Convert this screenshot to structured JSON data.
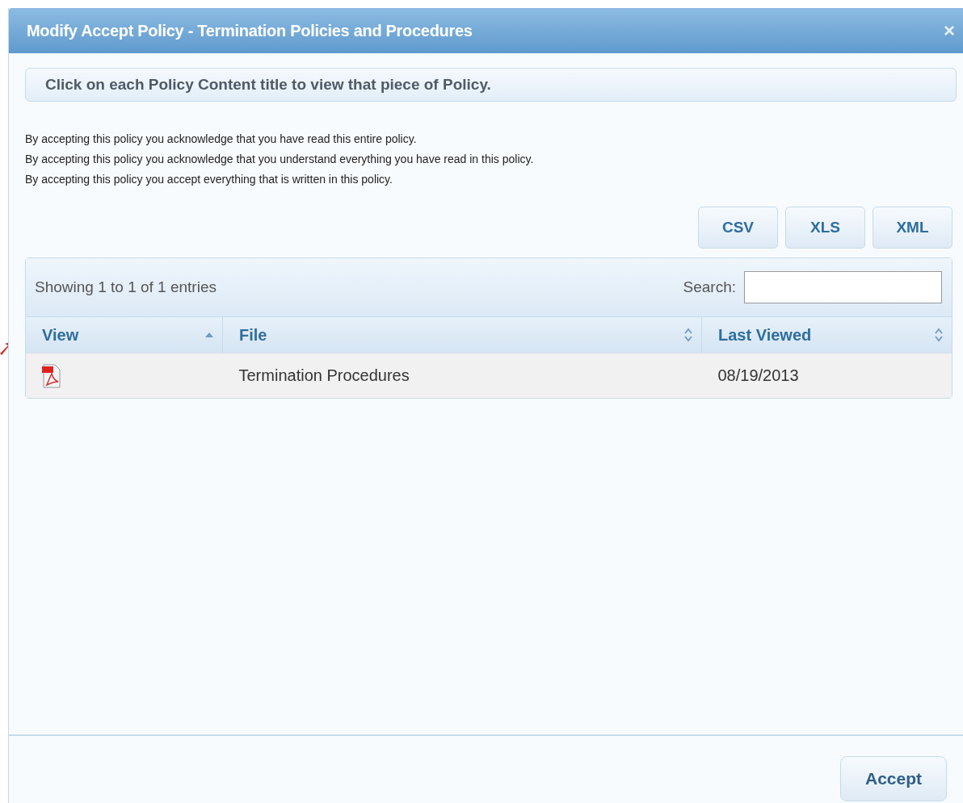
{
  "window": {
    "title": "Modify Accept Policy - Termination Policies and Procedures",
    "close": "×"
  },
  "info": "Click on each Policy Content title to view that piece of Policy.",
  "statements": [
    "By accepting this policy you acknowledge that you have read this entire policy.",
    "By accepting this policy you acknowledge that you understand everything you have read in this policy.",
    "By accepting this policy you accept everything that is written in this policy."
  ],
  "export_buttons": [
    "CSV",
    "XLS",
    "XML"
  ],
  "table": {
    "info": "Showing 1 to 1 of 1 entries",
    "search_label": "Search:",
    "columns": [
      {
        "label": "View",
        "sorted": true
      },
      {
        "label": "File",
        "sorted": false
      },
      {
        "label": "Last Viewed",
        "sorted": false
      }
    ],
    "rows": [
      {
        "file": "Termination Procedures",
        "last_viewed": "08/19/2013"
      }
    ]
  },
  "buttons": [
    "Accept"
  ]
}
